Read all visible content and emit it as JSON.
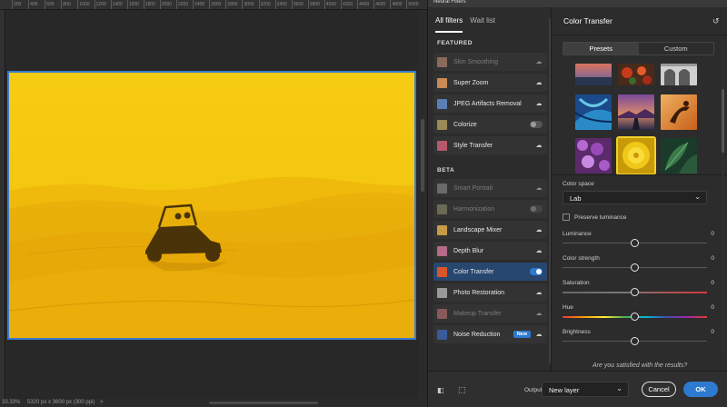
{
  "window": {
    "title": "Neural Filters"
  },
  "ruler": {
    "marks": [
      "200",
      "400",
      "600",
      "800",
      "1000",
      "1200",
      "1400",
      "1600",
      "1800",
      "2000",
      "2200",
      "2400",
      "2600",
      "2800",
      "3000",
      "3200",
      "3400",
      "3600",
      "3800",
      "4000",
      "4200",
      "4400",
      "4600",
      "4800",
      "5000"
    ]
  },
  "status": {
    "zoom": "33.33%",
    "dimensions": "5320 px x 3600 px (300 ppi)",
    "arrow": ">"
  },
  "filter_panel": {
    "tabs": [
      {
        "label": "All filters",
        "active": true
      },
      {
        "label": "Wait list",
        "active": false
      }
    ],
    "featured_heading": "FEATURED",
    "beta_heading": "BETA",
    "featured": [
      {
        "label": "Skin Smoothing",
        "control": "cloud",
        "dim": true,
        "thumb": "#8a6a5a"
      },
      {
        "label": "Super Zoom",
        "control": "cloud",
        "dim": false,
        "thumb": "#c98a55"
      },
      {
        "label": "JPEG Artifacts Removal",
        "control": "cloud",
        "dim": false,
        "thumb": "#5a7fb5"
      },
      {
        "label": "Colorize",
        "control": "toggle",
        "on": false,
        "dim": false,
        "thumb": "#9a8a55"
      },
      {
        "label": "Style Transfer",
        "control": "cloud",
        "dim": false,
        "thumb": "#b55a6a"
      }
    ],
    "beta": [
      {
        "label": "Smart Portrait",
        "control": "cloud",
        "dim": true,
        "thumb": "#6a6a6a"
      },
      {
        "label": "Harmonization",
        "control": "toggle",
        "on": false,
        "dim": true,
        "thumb": "#6a6a55"
      },
      {
        "label": "Landscape Mixer",
        "control": "cloud",
        "dim": false,
        "thumb": "#c99a45"
      },
      {
        "label": "Depth Blur",
        "control": "cloud",
        "dim": false,
        "thumb": "#b56a8a"
      },
      {
        "label": "Color Transfer",
        "control": "toggle",
        "on": true,
        "dim": false,
        "selected": true,
        "thumb": "#d9552a"
      },
      {
        "label": "Photo Restoration",
        "control": "cloud",
        "dim": false,
        "thumb": "#9a9a9a"
      },
      {
        "label": "Makeup Transfer",
        "control": "cloud",
        "dim": true,
        "thumb": "#8a5a5a"
      },
      {
        "label": "Noise Reduction",
        "control": "cloud",
        "dim": false,
        "badge": "New",
        "thumb": "#3a5a9a"
      }
    ]
  },
  "settings": {
    "title": "Color Transfer",
    "segments": [
      {
        "label": "Presets",
        "active": true
      },
      {
        "label": "Custom",
        "active": false
      }
    ],
    "color_space_label": "Color space",
    "color_space_value": "Lab",
    "preserve_label": "Preserve luminance",
    "sliders": [
      {
        "label": "Luminance",
        "value": "0",
        "level": 0.5,
        "style": "plain"
      },
      {
        "label": "Color strength",
        "value": "0",
        "level": 0.5,
        "style": "plain"
      },
      {
        "label": "Saturation",
        "value": "0",
        "level": 0.5,
        "style": "sat"
      },
      {
        "label": "Hue",
        "value": "0",
        "level": 0.5,
        "style": "hue"
      },
      {
        "label": "Brightness",
        "value": "0",
        "level": 0.5,
        "style": "plain"
      }
    ],
    "satisfied_prompt": "Are you satisfied with the results?"
  },
  "footer": {
    "output_label": "Output",
    "output_value": "New layer",
    "cancel_label": "Cancel",
    "ok_label": "OK"
  },
  "colors": {
    "accent": "#2e7ad1",
    "image_yellow": "#f1c40f",
    "selection_outline": "#f1d12a"
  }
}
